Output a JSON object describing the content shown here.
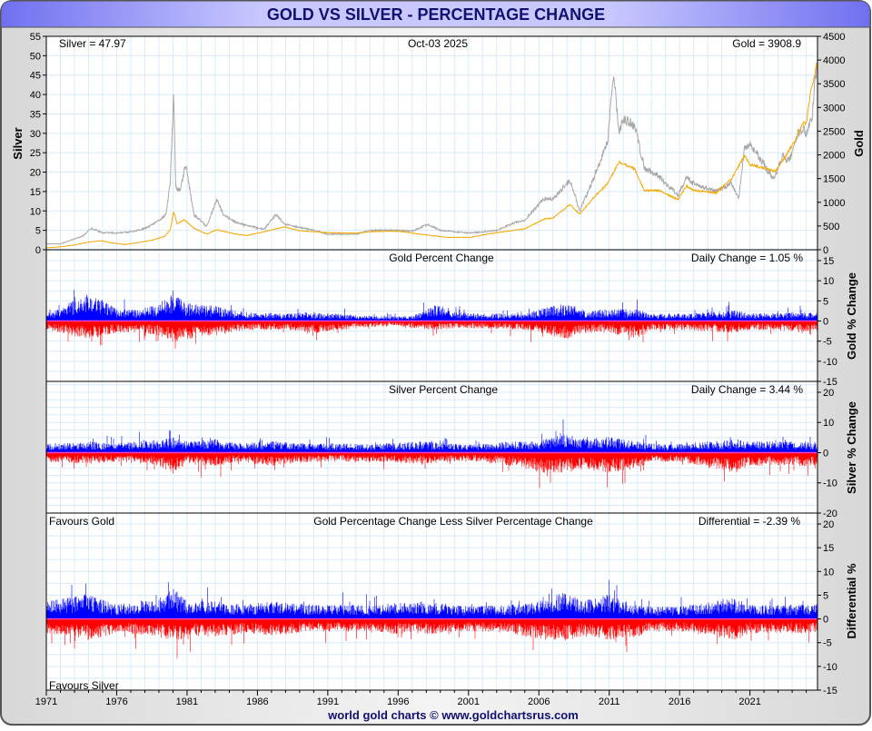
{
  "title": "GOLD VS SILVER - PERCENTAGE CHANGE",
  "footer": "world gold charts © www.goldchartsrus.com",
  "colors": {
    "silver": "#a8a8a8",
    "gold": "#f5a800",
    "up": "#0000ff",
    "down": "#ff0000",
    "zero": "#ff40c0",
    "grid": "#d8ecf8",
    "header": "#9090f8",
    "title": "#101070"
  },
  "chart_data": [
    {
      "type": "line",
      "id": "price",
      "labels": {
        "left": "Silver = 47.97",
        "center": "Oct-03  2025",
        "right": "Gold = 3908.9"
      },
      "ylabel_left": "Silver",
      "ylabel_right": "Gold",
      "ylim_left": [
        0,
        55
      ],
      "ylim_right": [
        0,
        4500
      ],
      "yticks_left": [
        0,
        5,
        10,
        15,
        20,
        25,
        30,
        35,
        40,
        45,
        50,
        55
      ],
      "yticks_right": [
        0,
        500,
        1000,
        1500,
        2000,
        2500,
        3000,
        3500,
        4000,
        4500
      ],
      "series": [
        {
          "name": "Silver",
          "axis": "left",
          "color": "silver",
          "x": [
            1971,
            1972,
            1973,
            1973.6,
            1974.2,
            1975,
            1976,
            1977,
            1978,
            1979,
            1979.5,
            1979.8,
            1980.05,
            1980.2,
            1980.5,
            1980.9,
            1981.5,
            1982.4,
            1983.1,
            1983.6,
            1984.5,
            1985.5,
            1986.5,
            1987.3,
            1988,
            1990,
            1991,
            1993,
            1994,
            1996,
            1997,
            1998.1,
            1999,
            2001,
            2002,
            2003,
            2004.3,
            2005,
            2006.3,
            2007,
            2008.2,
            2008.9,
            2009.5,
            2010.9,
            2011.3,
            2011.7,
            2012,
            2012.8,
            2013.5,
            2014.5,
            2015.9,
            2016.5,
            2017,
            2018.5,
            2019.7,
            2020.2,
            2020.6,
            2021.1,
            2021.8,
            2022.7,
            2023.3,
            2023.8,
            2024.4,
            2024.8,
            2025,
            2025.4,
            2025.75
          ],
          "y": [
            1.5,
            1.5,
            2.8,
            3.5,
            5.5,
            4.4,
            4.3,
            4.6,
            5.5,
            7.5,
            9,
            17,
            40,
            16,
            15,
            22,
            9,
            6,
            13,
            9,
            7,
            6,
            5.3,
            9,
            6.5,
            5,
            4,
            4,
            5,
            5,
            4.8,
            6.5,
            5,
            4.3,
            4.6,
            5,
            7,
            7.5,
            13,
            13,
            18,
            10,
            15,
            28,
            46,
            30,
            34,
            32,
            21,
            19,
            14,
            19,
            17,
            15,
            17,
            13,
            26,
            27,
            23,
            18,
            24,
            23,
            30,
            31,
            30,
            34,
            47.97
          ]
        },
        {
          "name": "Gold",
          "axis": "right",
          "color": "gold",
          "x": [
            1971,
            1972,
            1973,
            1974,
            1974.9,
            1975.5,
            1976.6,
            1977.5,
            1978.5,
            1979.4,
            1979.8,
            1980.05,
            1980.3,
            1980.8,
            1981.5,
            1982.4,
            1983.1,
            1984.5,
            1985.2,
            1986.5,
            1987.9,
            1989,
            1990,
            1991,
            1993,
            1994,
            1996,
            1997.5,
            1999.5,
            2001.2,
            2002,
            2003,
            2004,
            2005,
            2006.4,
            2007,
            2008.2,
            2008.9,
            2009.9,
            2010.9,
            2011.7,
            2012.8,
            2013.5,
            2014.5,
            2015.9,
            2016.5,
            2017,
            2018.6,
            2019.7,
            2020.6,
            2021,
            2022.8,
            2023.5,
            2024.2,
            2024.8,
            2025,
            2025.3,
            2025.75
          ],
          "y": [
            40,
            60,
            100,
            160,
            190,
            150,
            110,
            150,
            200,
            280,
            420,
            800,
            550,
            630,
            450,
            330,
            420,
            330,
            300,
            380,
            480,
            400,
            380,
            360,
            350,
            380,
            390,
            330,
            260,
            260,
            310,
            360,
            400,
            440,
            650,
            670,
            950,
            750,
            1100,
            1400,
            1850,
            1700,
            1250,
            1250,
            1060,
            1350,
            1250,
            1200,
            1500,
            1980,
            1800,
            1650,
            1950,
            2300,
            2700,
            2650,
            3300,
            3908.9
          ]
        }
      ]
    },
    {
      "type": "bar",
      "id": "gold_pct",
      "labels": {
        "center": "Gold Percent Change",
        "right": "Daily Change = 1.05 %"
      },
      "ylabel_right": "Gold % Change",
      "ylim": [
        -15,
        17.7
      ],
      "yticks": [
        -15,
        -10,
        -5,
        0,
        5,
        10,
        15
      ],
      "volatility_by_year": {
        "years": [
          1971,
          1973,
          1974,
          1975,
          1976,
          1978,
          1979,
          1980,
          1981,
          1983,
          1985,
          1988,
          1990,
          1993,
          1996,
          1997,
          1999,
          2000,
          2002,
          2005,
          2006,
          2008,
          2009,
          2011,
          2013,
          2014,
          2016,
          2020,
          2021,
          2025
        ],
        "up": [
          2,
          7,
          9,
          7,
          4,
          4,
          6,
          9,
          6,
          5,
          3,
          2.5,
          3,
          2,
          1.5,
          2,
          6,
          3,
          2.5,
          2.5,
          4,
          6,
          4,
          4,
          4,
          2.5,
          2.5,
          3.5,
          2.5,
          3
        ],
        "down": [
          3,
          5,
          6,
          5,
          4,
          4,
          5,
          7,
          6,
          5,
          3,
          3,
          4,
          2.5,
          1.5,
          2.5,
          3,
          2.5,
          2.5,
          3,
          4,
          6,
          4,
          4,
          6,
          3,
          3,
          4,
          3,
          3.5
        ]
      }
    },
    {
      "type": "bar",
      "id": "silver_pct",
      "labels": {
        "center": "Silver Percent Change",
        "right": "Daily Change = 3.44 %"
      },
      "ylabel_right": "Silver % Change",
      "ylim": [
        -20,
        23.6
      ],
      "yticks": [
        -20,
        -10,
        0,
        10,
        20
      ],
      "volatility_by_year": {
        "years": [
          1971,
          1974,
          1976,
          1979,
          1980,
          1981,
          1983,
          1985,
          1987,
          1990,
          1994,
          1998,
          2001,
          2004,
          2006,
          2008,
          2009,
          2011,
          2013,
          2014,
          2016,
          2020,
          2021,
          2025
        ],
        "up": [
          4,
          5,
          4,
          6,
          7,
          5,
          6,
          4,
          5,
          4,
          4,
          5,
          3.5,
          5,
          5,
          9,
          6,
          7,
          5,
          4,
          4,
          6,
          5,
          5
        ],
        "down": [
          4,
          5,
          4,
          6,
          9,
          5,
          6,
          4,
          6,
          4,
          4,
          5,
          3.5,
          6,
          9,
          9,
          7,
          9,
          7,
          4,
          4,
          9,
          6,
          6
        ]
      }
    },
    {
      "type": "bar",
      "id": "differential",
      "labels": {
        "left": "Favours Gold",
        "center": "Gold Percentage Change Less Silver Percentage Change",
        "right": "Differential = -2.39 %",
        "bottom_left": "Favours Silver"
      },
      "ylabel_right": "Differential %",
      "ylim": [
        -15,
        22.3
      ],
      "yticks": [
        -15,
        -10,
        -5,
        0,
        5,
        10,
        15,
        20
      ],
      "volatility_by_year": {
        "years": [
          1971,
          1974,
          1976,
          1979,
          1980,
          1981,
          1983,
          1985,
          1987,
          1990,
          1994,
          1998,
          2001,
          2004,
          2006,
          2008,
          2009,
          2011,
          2013,
          2014,
          2016,
          2020,
          2021,
          2025
        ],
        "up": [
          5,
          7,
          4,
          6,
          9,
          5,
          5,
          4,
          5,
          4,
          4,
          5,
          3.5,
          4,
          5,
          8,
          5,
          7,
          4,
          3.5,
          3.5,
          6,
          4,
          4
        ],
        "down": [
          4,
          6,
          4,
          5,
          7,
          5,
          5,
          4,
          5,
          3.5,
          4,
          4.5,
          3.5,
          4,
          6,
          6,
          5,
          6,
          5,
          3.5,
          3.5,
          6,
          4,
          4
        ]
      }
    }
  ],
  "xaxis": {
    "xlim": [
      1971,
      2025.8
    ],
    "ticks": [
      "1971",
      "1976",
      "1981",
      "1986",
      "1991",
      "1996",
      "2001",
      "2006",
      "2011",
      "2016",
      "2021"
    ]
  }
}
